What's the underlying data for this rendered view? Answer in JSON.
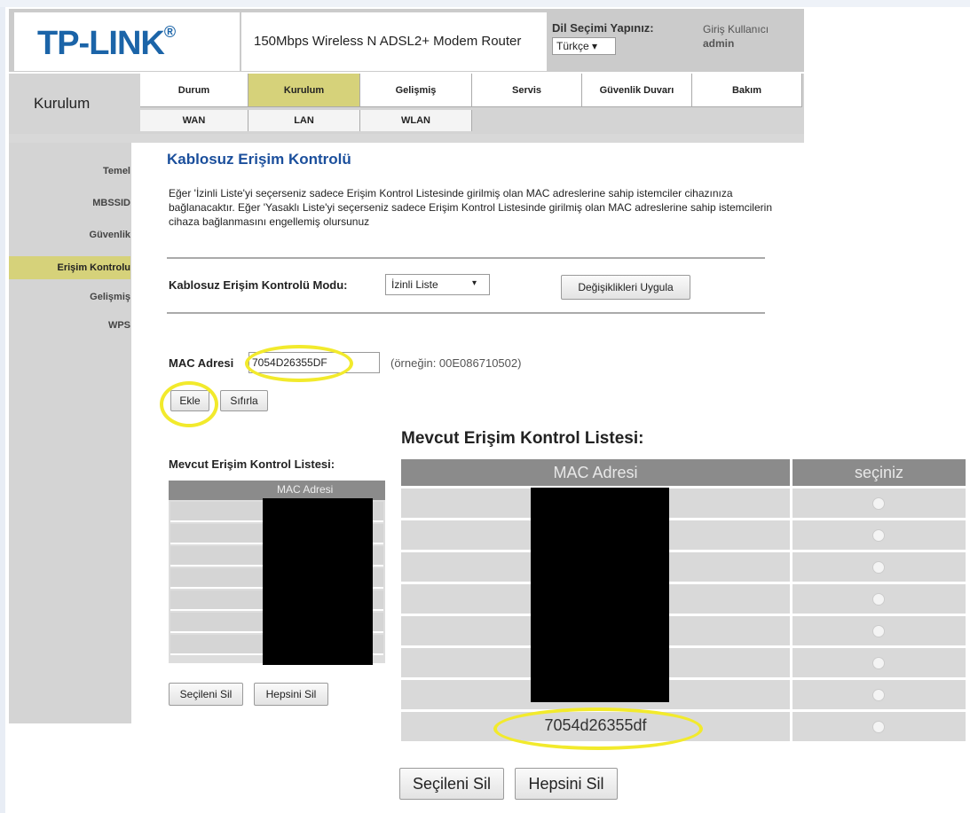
{
  "header": {
    "logo": "TP-LINK",
    "logo_mark": "®",
    "model": "150Mbps Wireless N ADSL2+ Modem Router",
    "language_label": "Dil Seçimi Yapınız:",
    "language_value": "Türkçe ▾",
    "user_label": "Giriş Kullanıcı",
    "user_name": "admin"
  },
  "nav": {
    "section": "Kurulum",
    "tabs": [
      "Durum",
      "Kurulum",
      "Gelişmiş",
      "Servis",
      "Güvenlik Duvarı",
      "Bakım"
    ],
    "active_tab": "Kurulum",
    "subtabs": [
      "WAN",
      "LAN",
      "WLAN"
    ]
  },
  "sidebar": {
    "items": [
      "Temel",
      "MBSSID",
      "Güvenlik",
      "Erişim Kontrolu",
      "Gelişmiş",
      "WPS"
    ],
    "active": "Erişim Kontrolu"
  },
  "content": {
    "title": "Kablosuz Erişim Kontrolü",
    "description": "Eğer 'İzinli Liste'yi seçerseniz sadece Erişim Kontrol Listesinde girilmiş olan MAC adreslerine sahip istemciler cihazınıza bağlanacaktır. Eğer 'Yasaklı Liste'yi seçerseniz sadece Erişim Kontrol Listesinde girilmiş olan MAC adreslerine sahip istemcilerin cihaza bağlanmasını engellemiş olursunuz",
    "mode_label": "Kablosuz Erişim Kontrolü Modu:",
    "mode_value": "İzinli Liste",
    "mode_arrow": "▾",
    "apply_button": "Değişiklikleri Uygula",
    "mac_label": "MAC Adresi",
    "mac_value": "7054D26355DF",
    "mac_example": "(örneğin: 00E086710502)",
    "add_button": "Ekle",
    "reset_button": "Sıfırla"
  },
  "small_table": {
    "title": "Mevcut Erişim Kontrol Listesi:",
    "header": "MAC Adresi",
    "row_count": 8,
    "delete_selected": "Seçileni Sil",
    "delete_all": "Hepsini Sil"
  },
  "big_table": {
    "title": "Mevcut Erişim Kontrol Listesi:",
    "col_mac": "MAC Adresi",
    "col_select": "seçiniz",
    "row_count": 8,
    "visible_mac": "7054d26355df",
    "delete_selected": "Seçileni Sil",
    "delete_all": "Hepsini Sil"
  },
  "colors": {
    "active_tab": "#d6d27a",
    "logo_blue": "#1b64a8",
    "title_blue": "#1b4f9c",
    "highlight": "#f2ea2c",
    "table_header": "#8b8b8b"
  }
}
